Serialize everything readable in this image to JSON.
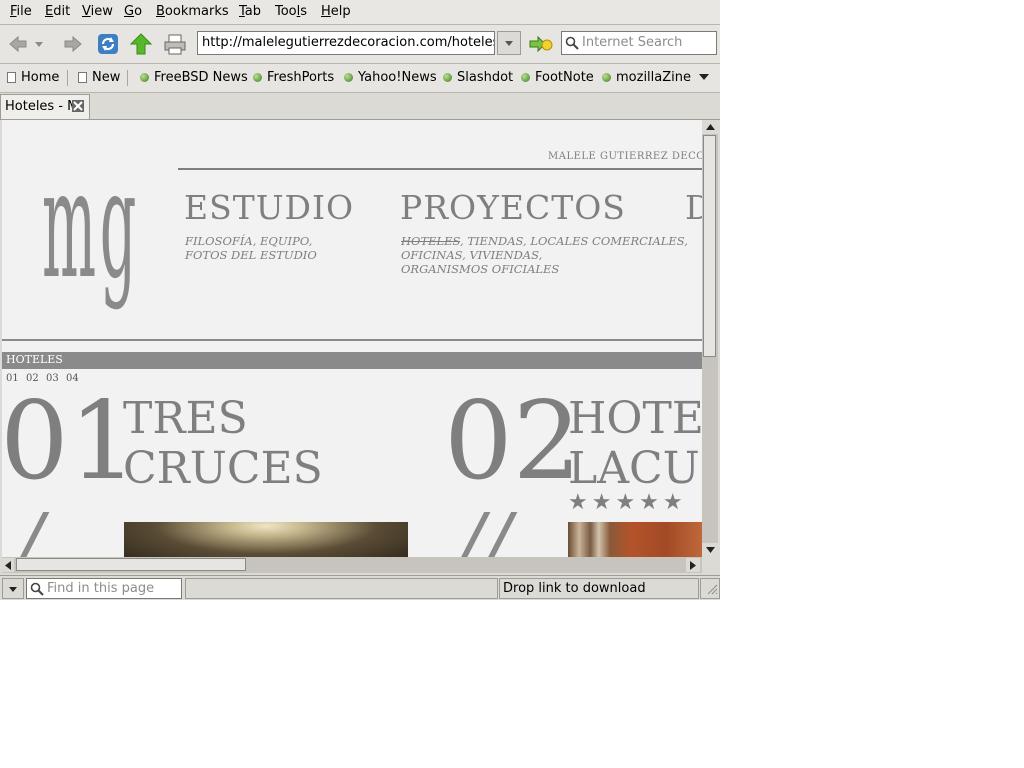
{
  "menubar": {
    "items": [
      {
        "label": "File",
        "ul": "F",
        "rest": "ile"
      },
      {
        "label": "Edit",
        "ul": "E",
        "rest": "dit"
      },
      {
        "label": "View",
        "ul": "V",
        "rest": "iew"
      },
      {
        "label": "Go",
        "ul": "G",
        "rest": "o"
      },
      {
        "label": "Bookmarks",
        "ul": "B",
        "rest": "ookmarks"
      },
      {
        "label": "Tab",
        "ul": "T",
        "rest": "ab"
      },
      {
        "label": "Tools",
        "pre": "Too",
        "ul": "l",
        "rest": "s"
      },
      {
        "label": "Help",
        "ul": "H",
        "rest": "elp"
      }
    ]
  },
  "navbar": {
    "url": "http://malelegutierrezdecoracion.com/hoteles",
    "search_placeholder": "Internet Search"
  },
  "bookmarks": {
    "items": [
      {
        "label": "Home",
        "icon": "page-icon"
      },
      {
        "label": "New",
        "icon": "page-icon"
      },
      {
        "label": "FreeBSD News",
        "icon": "rss-dot-icon"
      },
      {
        "label": "FreshPorts",
        "icon": "rss-dot-icon"
      },
      {
        "label": "Yahoo!News",
        "icon": "rss-dot-icon"
      },
      {
        "label": "Slashdot",
        "icon": "rss-dot-icon"
      },
      {
        "label": "FootNote",
        "icon": "rss-dot-icon"
      },
      {
        "label": "mozillaZine",
        "icon": "rss-dot-icon"
      }
    ]
  },
  "tab": {
    "title": "Hoteles - M"
  },
  "page": {
    "top_text": "MALELE GUTIERREZ DECORAC",
    "nav": [
      {
        "heading": "ESTUDIO",
        "sub_lines": [
          "FILOSOFÍA,  EQUIPO,",
          "FOTOS DEL ESTUDIO"
        ]
      },
      {
        "heading": "PROYECTOS",
        "sub_first": "HOTELES",
        "sub_first_rest": ",  TIENDAS,  LOCALES COMERCIALES,",
        "sub_lines": [
          "OFICINAS,  VIVIENDAS,",
          "ORGANISMOS OFICIALES"
        ]
      },
      {
        "heading": "D"
      }
    ],
    "section": "HOTELES",
    "pager": [
      "01",
      "02",
      "03",
      "04"
    ],
    "hotels": [
      {
        "number": "01",
        "title_lines": [
          "TRES",
          "CRUCES"
        ],
        "slash": "/"
      },
      {
        "number": "02",
        "title_lines": [
          "HOTEL",
          "LACUS"
        ],
        "stars": "★★★★★",
        "slash": "//"
      }
    ]
  },
  "status": {
    "find_placeholder": "Find in this page",
    "message": "Drop link to download"
  },
  "colors": {
    "chrome": "#dcdad5",
    "page_bg": "#f2f2f2",
    "page_text": "#7f7f7f",
    "section_bar": "#8a8a8a"
  }
}
